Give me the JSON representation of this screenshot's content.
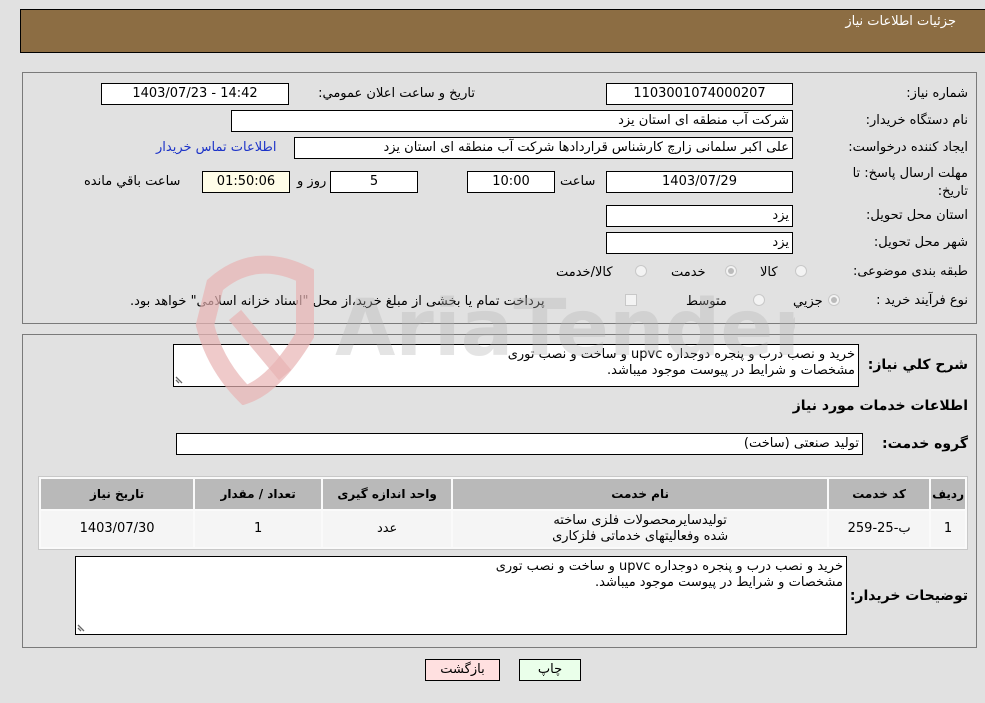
{
  "header": {
    "title": "جزئیات اطلاعات نیاز"
  },
  "form": {
    "need_number_label": "شماره نیاز:",
    "need_number": "1103001074000207",
    "announce_label": "تاريخ و ساعت اعلان عمومي:",
    "announce_value": "1403/07/23 - 14:42",
    "buyer_org_label": "نام دستگاه خريدار:",
    "buyer_org": "شرکت آب منطقه ای استان یزد",
    "creator_label": "ايجاد كننده درخواست:",
    "creator": "علی اکبر سلمانی زارچ کارشناس قراردادها شرکت آب منطقه ای استان یزد",
    "contact_link": "اطلاعات تماس خريدار",
    "deadline_label": "مهلت ارسال پاسخ: تا تاريخ:",
    "deadline_date": "1403/07/29",
    "time_label": "ساعت",
    "deadline_time": "10:00",
    "days_value": "5",
    "days_label": "روز و",
    "remaining_value": "01:50:06",
    "remaining_label": "ساعت باقي مانده",
    "province_label": "استان محل تحويل:",
    "province": "یزد",
    "city_label": "شهر محل تحويل:",
    "city": "یزد",
    "category_label": "طبقه بندی موضوعی:",
    "category_options": [
      {
        "label": "کالا",
        "checked": false
      },
      {
        "label": "خدمت",
        "checked": true
      },
      {
        "label": "کالا/خدمت",
        "checked": false
      }
    ],
    "process_label": "نوع فرآيند خريد :",
    "process_options": [
      {
        "label": "جزيي",
        "checked": true
      },
      {
        "label": "متوسط",
        "checked": false
      }
    ],
    "treasury_note": "پرداخت تمام یا بخشی از مبلغ خرید،از محل \"اسناد خزانه اسلامی\" خواهد بود."
  },
  "details": {
    "description_label": "شرح كلي نياز:",
    "description": "خرید و نصب درب و پنجره دوجداره upvc و ساخت و نصب توری\nمشخصات و شرایط در پیوست موجود میباشد.",
    "services_heading": "اطلاعات خدمات مورد نياز",
    "service_group_label": "گروه خدمت:",
    "service_group": "تولید صنعتی (ساخت)",
    "table": {
      "headers": [
        "رديف",
        "كد خدمت",
        "نام خدمت",
        "واحد اندازه گيری",
        "تعداد / مقدار",
        "تاريخ نياز"
      ],
      "rows": [
        [
          "1",
          "ب-25-259",
          "تولیدسایرمحصولات فلزی ساخته شده وفعالیتهای خدماتی فلزکاری",
          "عدد",
          "1",
          "1403/07/30"
        ]
      ]
    },
    "buyer_notes_label": "توضيحات خريدار:",
    "buyer_notes": "خرید و نصب درب و پنجره دوجداره upvc و ساخت و نصب توری\nمشخصات و شرایط در پیوست موجود میباشد."
  },
  "buttons": {
    "print": "چاپ",
    "back": "بازگشت"
  },
  "watermark": {
    "text": "AriaTender.neT"
  },
  "colors": {
    "header_bg": "#8c6d43",
    "print_bg": "#eaffea",
    "back_bg": "#ffe0e0",
    "link": "#1c33c8"
  }
}
